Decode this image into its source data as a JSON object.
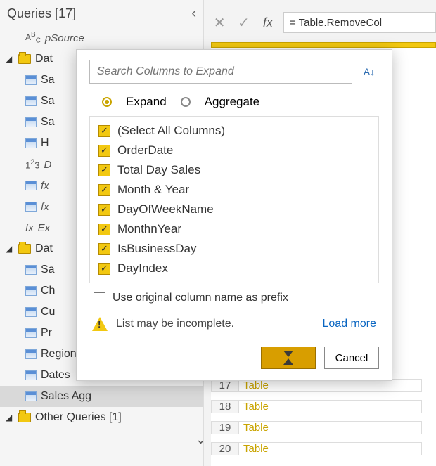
{
  "queriesPanel": {
    "title": "Queries [17]",
    "psource": "pSource",
    "group1": "Dat",
    "items1": [
      "Sa",
      "Sa",
      "Sa",
      "H",
      "D",
      "fx",
      "fx",
      "Ex"
    ],
    "group2": "Dat",
    "items2": [
      "Sa",
      "Ch",
      "Cu",
      "Pr",
      "Regions",
      "Dates",
      "Sales Agg"
    ],
    "group3": "Other Queries [1]"
  },
  "formulaBar": {
    "formula": "= Table.RemoveCol"
  },
  "popup": {
    "searchPlaceholder": "Search Columns to Expand",
    "radioExpand": "Expand",
    "radioAggregate": "Aggregate",
    "columns": [
      "(Select All Columns)",
      "OrderDate",
      "Total Day Sales",
      "Month & Year",
      "DayOfWeekName",
      "MonthnYear",
      "IsBusinessDay",
      "DayIndex"
    ],
    "prefix": "Use original column name as prefix",
    "warning": "List may be incomplete.",
    "loadMore": "Load more",
    "cancel": "Cancel"
  },
  "dataTable": {
    "rows": [
      {
        "idx": "17",
        "val": "Table"
      },
      {
        "idx": "18",
        "val": "Table"
      },
      {
        "idx": "19",
        "val": "Table"
      },
      {
        "idx": "20",
        "val": "Table"
      }
    ]
  }
}
